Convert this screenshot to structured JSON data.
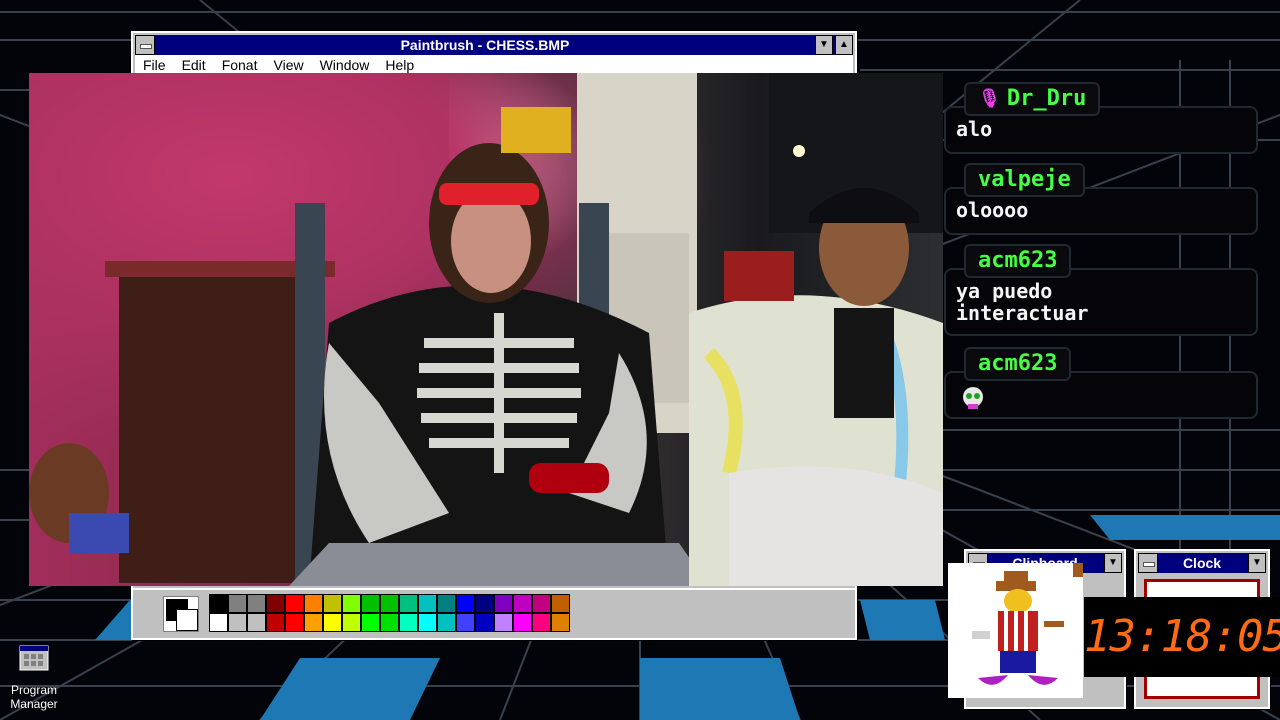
{
  "paintbrush": {
    "title": "Paintbrush - CHESS.BMP",
    "menu": [
      {
        "label": "File"
      },
      {
        "label": "Edit"
      },
      {
        "label": "Fonat"
      },
      {
        "label": "View"
      },
      {
        "label": "Window"
      },
      {
        "label": "Help"
      }
    ],
    "palette_row1": [
      "#000000",
      "#808080",
      "#808080",
      "#800000",
      "#ff0000",
      "#ff8000",
      "#c0c000",
      "#80ff00",
      "#00c000",
      "#00c000",
      "#00c080",
      "#00c0c0",
      "#008080",
      "#0000ff",
      "#000080",
      "#8000c0",
      "#c000c0",
      "#c00080",
      "#c06000"
    ],
    "palette_row2": [
      "#ffffff",
      "#c0c0c0",
      "#c0c0c0",
      "#c00000",
      "#ff0000",
      "#ffa000",
      "#ffff00",
      "#c0ff00",
      "#00ff00",
      "#00e000",
      "#00ffc0",
      "#00ffff",
      "#00c0c0",
      "#4040ff",
      "#0000c0",
      "#c080ff",
      "#ff00ff",
      "#ff0080",
      "#e08000"
    ]
  },
  "chat": {
    "messages": [
      {
        "user": "Dr_Dru",
        "text": "alo",
        "has_mic": true
      },
      {
        "user": "valpeje",
        "text": "oloooo"
      },
      {
        "user": "acm623",
        "text": "ya puedo interactuar"
      },
      {
        "user": "acm623",
        "text": "",
        "emote": "skull-emote-icon"
      }
    ]
  },
  "clipboard": {
    "title": "Clipboard"
  },
  "clock_window": {
    "title": "Clock"
  },
  "digital_clock": "13:18:05",
  "desktop": {
    "program_manager_label": "Program Manager"
  },
  "colors": {
    "titlebar": "#00007f",
    "chat_username": "#44ff44",
    "clock_digits": "#ff6a14"
  }
}
